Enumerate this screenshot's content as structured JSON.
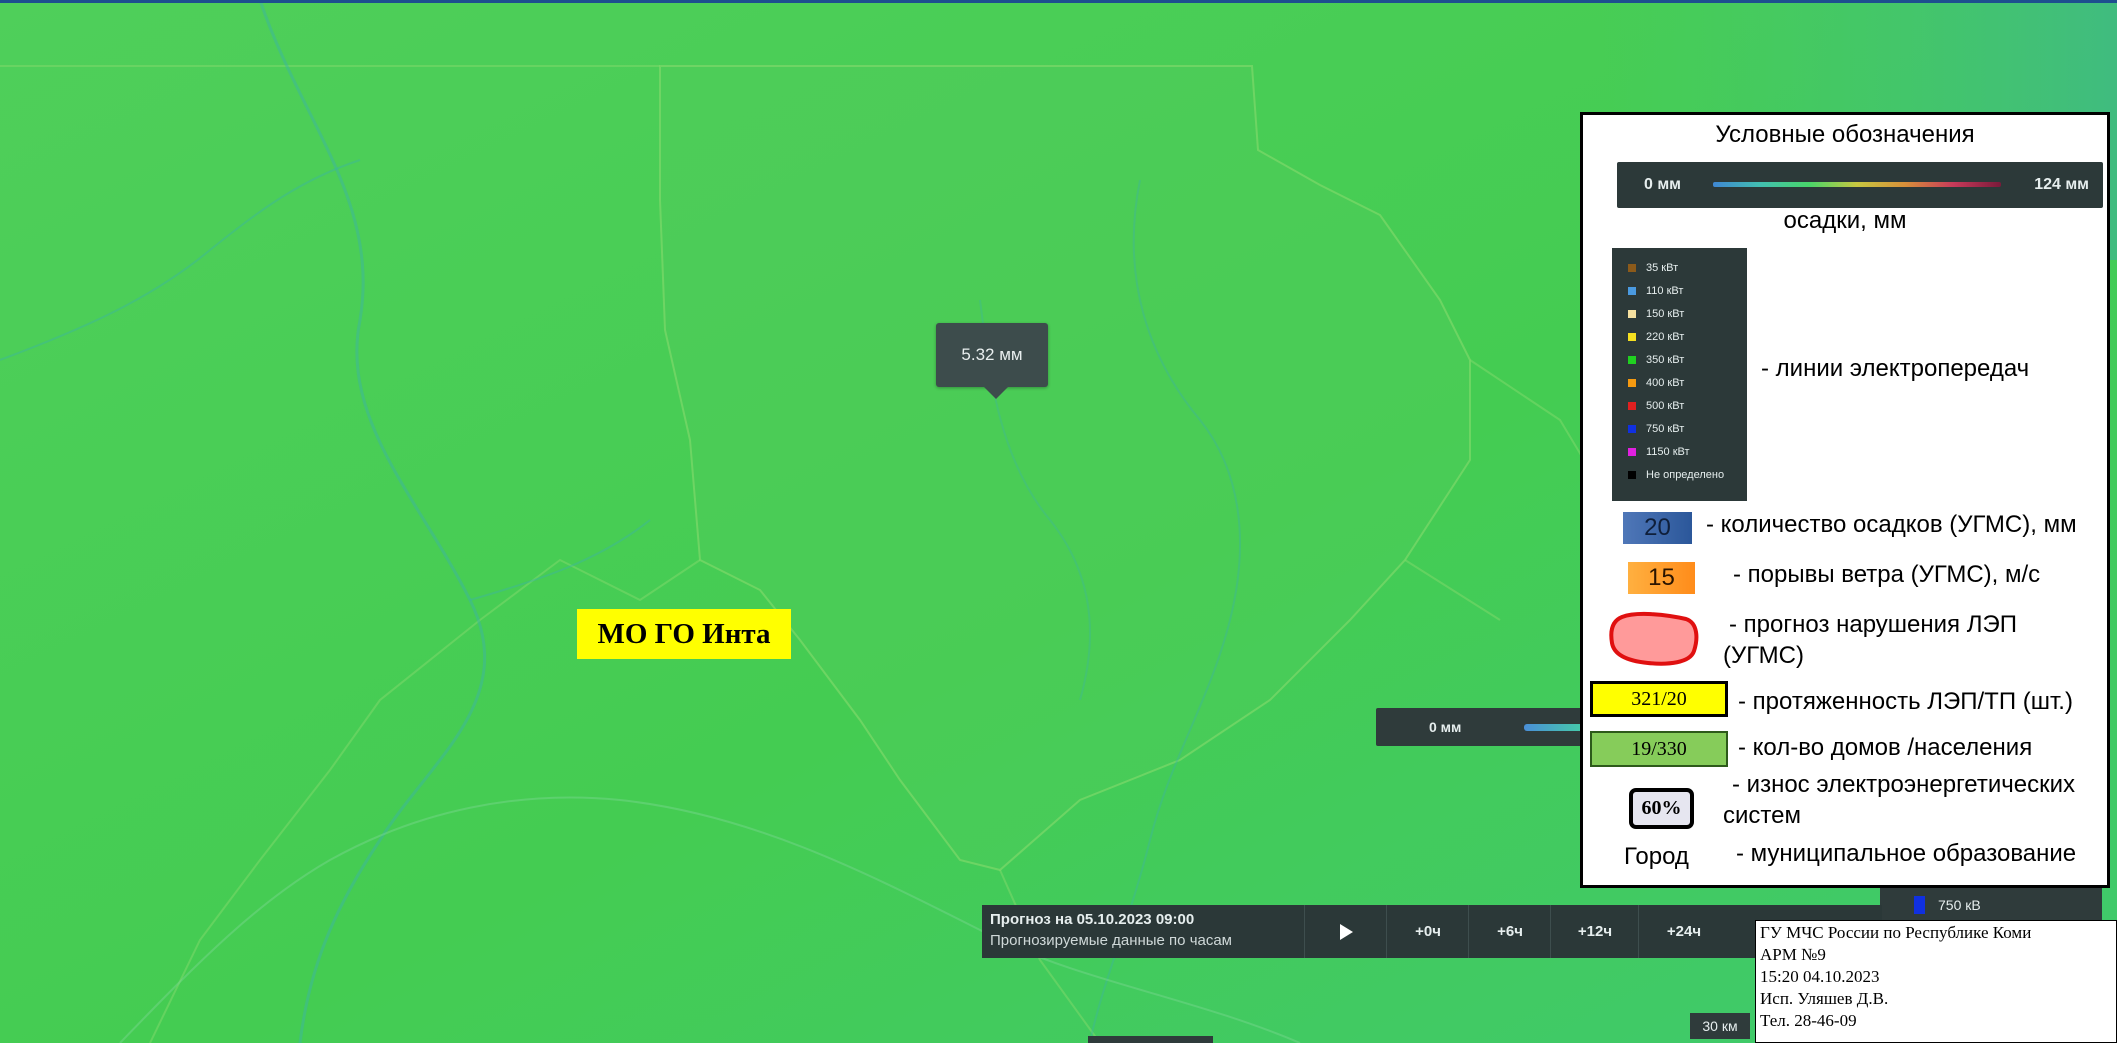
{
  "map": {
    "point_value_label": "5.32 мм",
    "municipality_label": "МО ГО Инта",
    "precip_scale_min_label": "0 мм",
    "scale_bar_label": "30 км",
    "power_line_chip_label": "750 кВ",
    "power_line_chip_color": "#1030e0"
  },
  "forecast_bar": {
    "title": "Прогноз на 05.10.2023 09:00",
    "subtitle": "Прогнозируемые данные по часам",
    "play_icon": "play-icon",
    "steps": [
      "+0ч",
      "+6ч",
      "+12ч",
      "+24ч"
    ]
  },
  "legend": {
    "title": "Условные обозначения",
    "precip_gradient": {
      "min_label": "0 мм",
      "max_label": "124 мм",
      "caption": "осадки, мм"
    },
    "power_lines": {
      "caption": "- линии электропередач",
      "items": [
        {
          "label": "35 кВт",
          "color": "#8b5a1a"
        },
        {
          "label": "110 кВт",
          "color": "#4a9ae0"
        },
        {
          "label": "150 кВт",
          "color": "#f5e0a0"
        },
        {
          "label": "220 кВт",
          "color": "#f5e020"
        },
        {
          "label": "350 кВт",
          "color": "#20d020"
        },
        {
          "label": "400 кВт",
          "color": "#f59a10"
        },
        {
          "label": "500 кВт",
          "color": "#e02020"
        },
        {
          "label": "750 кВт",
          "color": "#1030e0"
        },
        {
          "label": "1150 кВт",
          "color": "#e020e0"
        },
        {
          "label": "Не определено",
          "color": "#000000"
        }
      ]
    },
    "precip_ugms": {
      "value": "20",
      "caption": "- количество осадков (УГМС), мм"
    },
    "wind_ugms": {
      "value": "15",
      "caption": "- порывы ветра (УГМС), м/с"
    },
    "line_failure": {
      "caption_line1": "- прогноз нарушения ЛЭП",
      "caption_line2": "(УГМС)"
    },
    "line_length": {
      "value": "321/20",
      "caption": "- протяженность ЛЭП/ТП (шт.)"
    },
    "houses": {
      "value": "19/330",
      "caption": "- кол-во домов /населения"
    },
    "wear": {
      "value": "60%",
      "caption_line1": "- износ электроэнергетических",
      "caption_line2": "систем"
    },
    "city": {
      "label": "Город",
      "caption": "- муниципальное образование"
    }
  },
  "stamp": {
    "line1": "ГУ МЧС России по Республике Коми",
    "line2": "АРМ №9",
    "line3": "15:20  04.10.2023",
    "line4": "Исп. Уляшев Д.В.",
    "line5": "Тел. 28-46-09"
  }
}
